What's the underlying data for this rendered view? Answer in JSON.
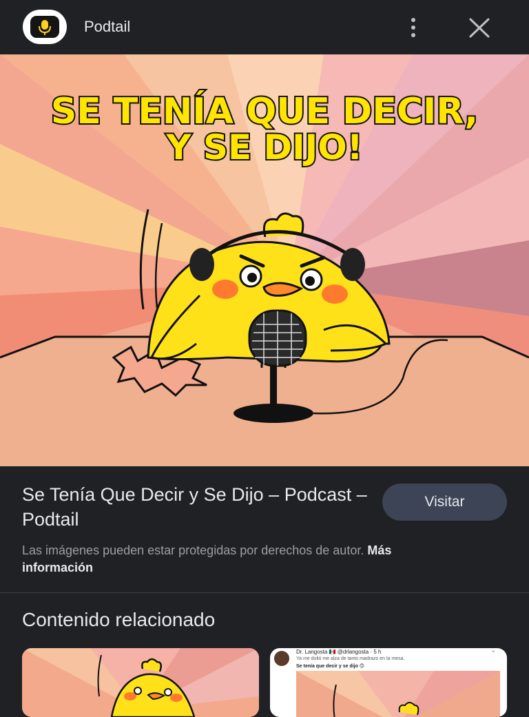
{
  "header": {
    "app_name": "Podtail",
    "more_icon": "more-vert-icon",
    "close_icon": "close-icon"
  },
  "hero": {
    "title_line1": "SE TENÍA QUE DECIR,",
    "title_line2": "Y SE DIJO!",
    "colors": {
      "title_fill": "#ffe500",
      "title_stroke": "#111111",
      "chick": "#ffe11a",
      "background": "#f4a88a"
    }
  },
  "info": {
    "title": "Se Tenía Que Decir y Se Dijo – Podcast – Podtail",
    "visit_label": "Visitar",
    "copyright_text": "Las imágenes pueden estar protegidas por derechos de autor.",
    "more_info_label": "Más información"
  },
  "related": {
    "heading": "Contenido relacionado",
    "card2": {
      "author": "Dr. Langosta 🇲🇽 @drlangosta · 5 h",
      "text": "Ya me dolió me alza de tanto madrazo en la mesa.",
      "caption": "Se tenía que decir y se dijo 😊"
    }
  }
}
